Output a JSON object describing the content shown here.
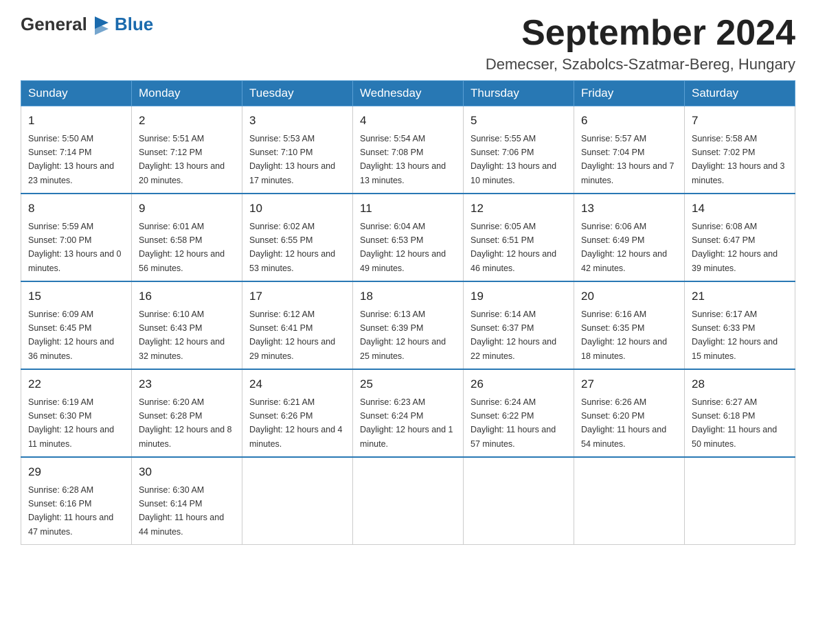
{
  "header": {
    "logo": {
      "general": "General",
      "flag_shape": "▶",
      "blue": "Blue"
    },
    "title": "September 2024",
    "location": "Demecser, Szabolcs-Szatmar-Bereg, Hungary"
  },
  "weekdays": [
    "Sunday",
    "Monday",
    "Tuesday",
    "Wednesday",
    "Thursday",
    "Friday",
    "Saturday"
  ],
  "weeks": [
    [
      {
        "day": "1",
        "sunrise": "5:50 AM",
        "sunset": "7:14 PM",
        "daylight": "13 hours and 23 minutes."
      },
      {
        "day": "2",
        "sunrise": "5:51 AM",
        "sunset": "7:12 PM",
        "daylight": "13 hours and 20 minutes."
      },
      {
        "day": "3",
        "sunrise": "5:53 AM",
        "sunset": "7:10 PM",
        "daylight": "13 hours and 17 minutes."
      },
      {
        "day": "4",
        "sunrise": "5:54 AM",
        "sunset": "7:08 PM",
        "daylight": "13 hours and 13 minutes."
      },
      {
        "day": "5",
        "sunrise": "5:55 AM",
        "sunset": "7:06 PM",
        "daylight": "13 hours and 10 minutes."
      },
      {
        "day": "6",
        "sunrise": "5:57 AM",
        "sunset": "7:04 PM",
        "daylight": "13 hours and 7 minutes."
      },
      {
        "day": "7",
        "sunrise": "5:58 AM",
        "sunset": "7:02 PM",
        "daylight": "13 hours and 3 minutes."
      }
    ],
    [
      {
        "day": "8",
        "sunrise": "5:59 AM",
        "sunset": "7:00 PM",
        "daylight": "13 hours and 0 minutes."
      },
      {
        "day": "9",
        "sunrise": "6:01 AM",
        "sunset": "6:58 PM",
        "daylight": "12 hours and 56 minutes."
      },
      {
        "day": "10",
        "sunrise": "6:02 AM",
        "sunset": "6:55 PM",
        "daylight": "12 hours and 53 minutes."
      },
      {
        "day": "11",
        "sunrise": "6:04 AM",
        "sunset": "6:53 PM",
        "daylight": "12 hours and 49 minutes."
      },
      {
        "day": "12",
        "sunrise": "6:05 AM",
        "sunset": "6:51 PM",
        "daylight": "12 hours and 46 minutes."
      },
      {
        "day": "13",
        "sunrise": "6:06 AM",
        "sunset": "6:49 PM",
        "daylight": "12 hours and 42 minutes."
      },
      {
        "day": "14",
        "sunrise": "6:08 AM",
        "sunset": "6:47 PM",
        "daylight": "12 hours and 39 minutes."
      }
    ],
    [
      {
        "day": "15",
        "sunrise": "6:09 AM",
        "sunset": "6:45 PM",
        "daylight": "12 hours and 36 minutes."
      },
      {
        "day": "16",
        "sunrise": "6:10 AM",
        "sunset": "6:43 PM",
        "daylight": "12 hours and 32 minutes."
      },
      {
        "day": "17",
        "sunrise": "6:12 AM",
        "sunset": "6:41 PM",
        "daylight": "12 hours and 29 minutes."
      },
      {
        "day": "18",
        "sunrise": "6:13 AM",
        "sunset": "6:39 PM",
        "daylight": "12 hours and 25 minutes."
      },
      {
        "day": "19",
        "sunrise": "6:14 AM",
        "sunset": "6:37 PM",
        "daylight": "12 hours and 22 minutes."
      },
      {
        "day": "20",
        "sunrise": "6:16 AM",
        "sunset": "6:35 PM",
        "daylight": "12 hours and 18 minutes."
      },
      {
        "day": "21",
        "sunrise": "6:17 AM",
        "sunset": "6:33 PM",
        "daylight": "12 hours and 15 minutes."
      }
    ],
    [
      {
        "day": "22",
        "sunrise": "6:19 AM",
        "sunset": "6:30 PM",
        "daylight": "12 hours and 11 minutes."
      },
      {
        "day": "23",
        "sunrise": "6:20 AM",
        "sunset": "6:28 PM",
        "daylight": "12 hours and 8 minutes."
      },
      {
        "day": "24",
        "sunrise": "6:21 AM",
        "sunset": "6:26 PM",
        "daylight": "12 hours and 4 minutes."
      },
      {
        "day": "25",
        "sunrise": "6:23 AM",
        "sunset": "6:24 PM",
        "daylight": "12 hours and 1 minute."
      },
      {
        "day": "26",
        "sunrise": "6:24 AM",
        "sunset": "6:22 PM",
        "daylight": "11 hours and 57 minutes."
      },
      {
        "day": "27",
        "sunrise": "6:26 AM",
        "sunset": "6:20 PM",
        "daylight": "11 hours and 54 minutes."
      },
      {
        "day": "28",
        "sunrise": "6:27 AM",
        "sunset": "6:18 PM",
        "daylight": "11 hours and 50 minutes."
      }
    ],
    [
      {
        "day": "29",
        "sunrise": "6:28 AM",
        "sunset": "6:16 PM",
        "daylight": "11 hours and 47 minutes."
      },
      {
        "day": "30",
        "sunrise": "6:30 AM",
        "sunset": "6:14 PM",
        "daylight": "11 hours and 44 minutes."
      },
      null,
      null,
      null,
      null,
      null
    ]
  ]
}
